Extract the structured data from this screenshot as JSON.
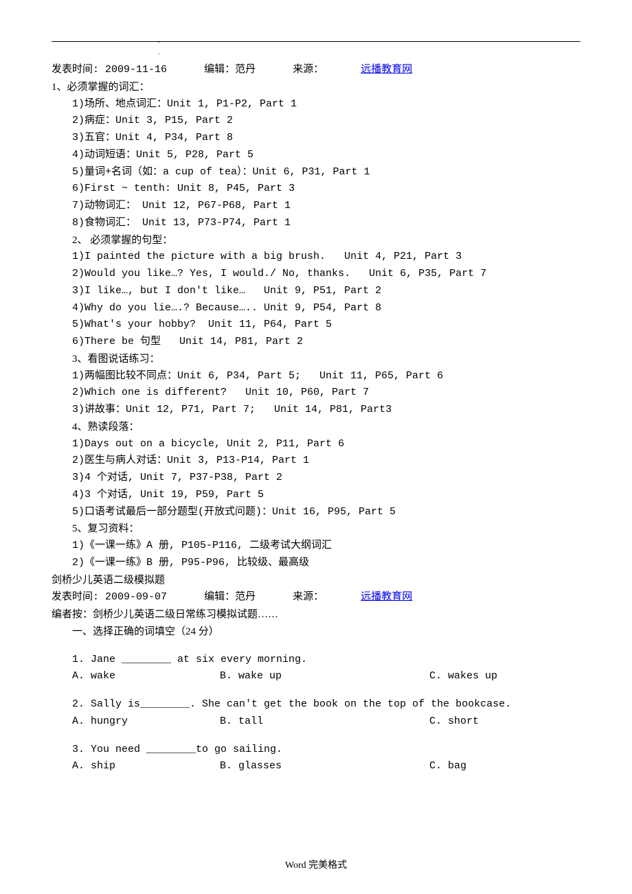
{
  "header": {
    "publish_date": "发表时间: 2009-11-16",
    "editor_label": "编辑：",
    "editor_name": "范丹",
    "source_label": "来源：",
    "source_link": "远播教育网"
  },
  "section1": {
    "title": "1、必须掌握的词汇：",
    "items": [
      "1)场所、地点词汇：Unit 1, P1-P2, Part 1",
      "2)病症：Unit 3, P15, Part 2",
      "3)五官：Unit 4, P34, Part 8",
      "4)动词短语：Unit 5, P28, Part 5",
      "5)量词+名词（如：a cup of tea）：Unit 6, P31, Part 1",
      "6)First ~ tenth: Unit 8, P45, Part 3",
      "7)动物词汇： Unit 12, P67-P68, Part 1",
      "8)食物词汇： Unit 13, P73-P74, Part 1"
    ]
  },
  "section2": {
    "title": "2、 必须掌握的句型：",
    "items": [
      "1)I painted the picture with a big brush.   Unit 4, P21, Part 3",
      "2)Would you like…? Yes, I would./ No, thanks.   Unit 6, P35, Part 7",
      "3)I like…, but I don't like…   Unit 9, P51, Part 2",
      "4)Why do you lie….? Because….. Unit 9, P54, Part 8",
      "5)What's your hobby?  Unit 11, P64, Part 5",
      "6)There be 句型   Unit 14, P81, Part 2"
    ]
  },
  "section3": {
    "title": "3、看图说话练习：",
    "items": [
      "1)两幅图比较不同点：Unit 6, P34, Part 5;   Unit 11, P65, Part 6",
      "2)Which one is different?   Unit 10, P60, Part 7",
      "3)讲故事：Unit 12, P71, Part 7;   Unit 14, P81, Part3"
    ]
  },
  "section4": {
    "title": "4、熟读段落：",
    "items": [
      "1)Days out on a bicycle, Unit 2, P11, Part 6",
      "2)医生与病人对话：Unit 3, P13-P14, Part 1",
      "3)4 个对话, Unit 7, P37-P38, Part 2",
      "4)3 个对话, Unit 19, P59, Part 5",
      "5)口语考试最后一部分题型(开放式问题)：Unit 16, P95, Part 5"
    ]
  },
  "section5": {
    "title": "5、复习资料：",
    "items": [
      "1)《一课一练》A 册, P105-P116, 二级考试大纲词汇",
      "2)《一课一练》B 册, P95-P96, 比较级、最高级"
    ]
  },
  "mock": {
    "title": "剑桥少儿英语二级模拟题",
    "publish_date": "发表时间: 2009-09-07",
    "editor_label": "编辑：",
    "editor_name": "范丹",
    "source_label": "来源：",
    "source_link": "远播教育网",
    "editor_note": "编者按：剑桥少儿英语二级日常练习模拟试题……",
    "part1_title": "一、选择正确的词填空（24 分）"
  },
  "questions": [
    {
      "stem": "1. Jane ________ at six every morning.",
      "a": "A. wake",
      "b": "B. wake up",
      "c": "C. wakes up"
    },
    {
      "stem": "2. Sally is________. She can't get the book on the top of the bookcase.",
      "a": "A. hungry",
      "b": "B. tall",
      "c": "C. short"
    },
    {
      "stem": "3. You need ________to go sailing.",
      "a": "A. ship",
      "b": "B. glasses",
      "c": "C. bag"
    }
  ],
  "footer": "Word 完美格式"
}
